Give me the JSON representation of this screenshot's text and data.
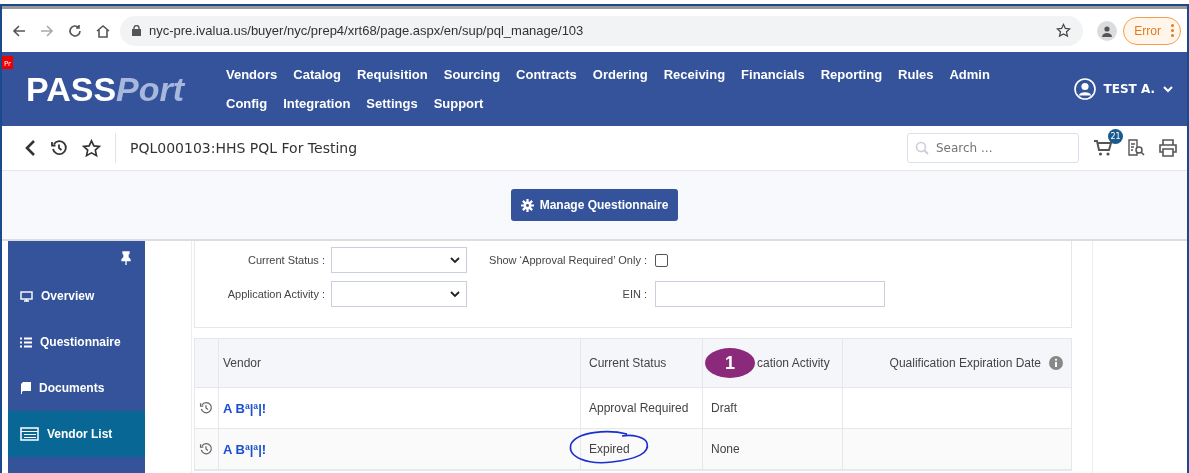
{
  "browser": {
    "url": "nyc-pre.ivalua.us/buyer/nyc/prep4/xrt68/page.aspx/en/sup/pql_manage/103",
    "error_label": "Error"
  },
  "nav": {
    "env_tag": "Pr",
    "logo_main": "PASS",
    "logo_accent": "Port",
    "items": [
      "Vendors",
      "Catalog",
      "Requisition",
      "Sourcing",
      "Contracts",
      "Ordering",
      "Receiving",
      "Financials",
      "Reporting",
      "Rules",
      "Admin",
      "Config",
      "Integration",
      "Settings",
      "Support"
    ],
    "user": "TEST A."
  },
  "header": {
    "title": "PQL000103:HHS PQL For Testing",
    "search_placeholder": "Search ...",
    "cart_count": "21"
  },
  "toolbar": {
    "button": "Manage Questionnaire"
  },
  "sidebar": {
    "items": [
      {
        "label": "Overview",
        "kind": "monitor",
        "selected": false
      },
      {
        "label": "Questionnaire",
        "kind": "list",
        "selected": false
      },
      {
        "label": "Documents",
        "kind": "book",
        "selected": false
      },
      {
        "label": "Vendor List",
        "kind": "table",
        "selected": true
      }
    ]
  },
  "filters": {
    "current_status": "Current Status :",
    "application_activity": "Application Activity :",
    "approval_only": {
      "label": "Show ‘Approval Required’ Only :",
      "checked": false
    },
    "ein": "EIN :"
  },
  "table": {
    "columns": [
      "Vendor",
      "Current Status",
      "cation Activity",
      "Qualification Expiration Date"
    ],
    "badge": "1",
    "rows": [
      {
        "vendor": "A Bª|ª|!",
        "status": "Approval Required",
        "activity": "Draft",
        "circled": false
      },
      {
        "vendor": "A Bª|ª|!",
        "status": "Expired",
        "activity": "None",
        "circled": true
      }
    ]
  }
}
